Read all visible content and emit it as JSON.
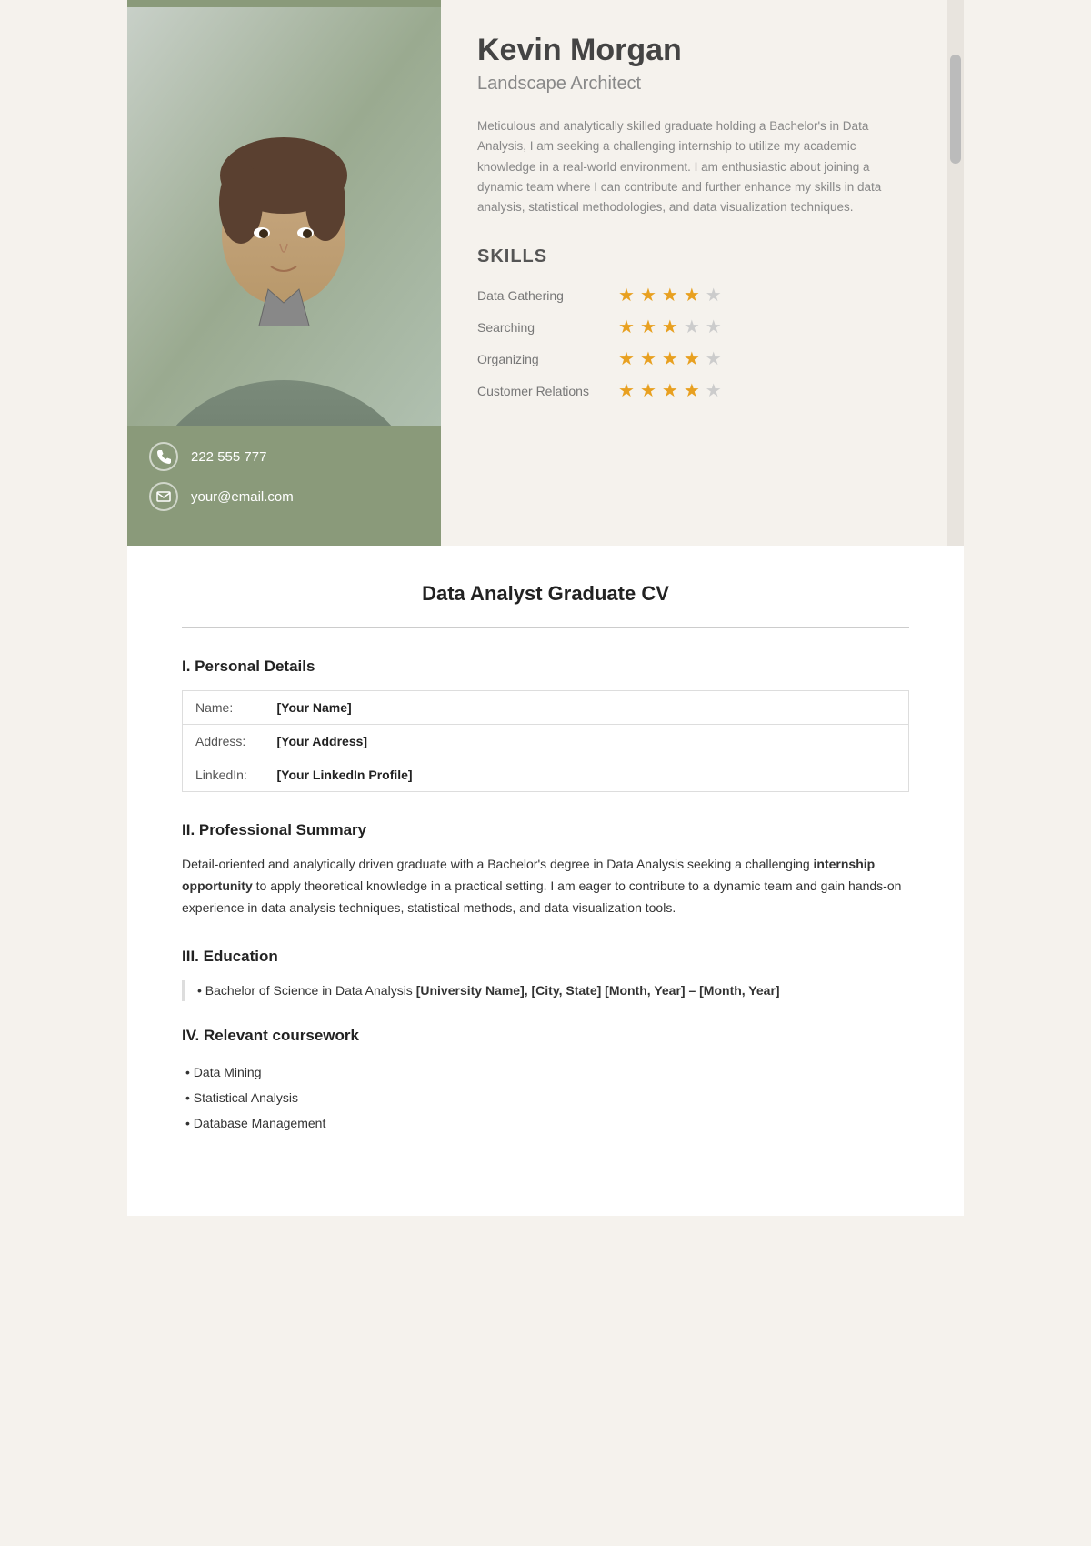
{
  "cv": {
    "name": "Kevin Morgan",
    "title": "Landscape Architect",
    "summary": "Meticulous and analytically skilled graduate holding a Bachelor's in Data Analysis, I am seeking a challenging internship to utilize my academic knowledge in a real-world environment. I am enthusiastic about joining a dynamic team where I can contribute and further enhance my skills in data analysis, statistical methodologies, and data visualization techniques.",
    "contact": {
      "phone": "222 555 777",
      "email": "your@email.com"
    },
    "skills_heading": "SKILLS",
    "skills": [
      {
        "name": "Data Gathering",
        "filled": 4,
        "empty": 1
      },
      {
        "name": "Searching",
        "filled": 3,
        "empty": 2
      },
      {
        "name": "Organizing",
        "filled": 4,
        "empty": 1
      },
      {
        "name": "Customer Relations",
        "filled": 4,
        "empty": 1
      }
    ]
  },
  "document": {
    "title": "Data Analyst Graduate CV",
    "sections": {
      "personal": {
        "heading": "I. Personal Details",
        "rows": [
          {
            "label": "Name:",
            "value": "[Your Name]"
          },
          {
            "label": "Address:",
            "value": "[Your Address]"
          },
          {
            "label": "LinkedIn:",
            "value": "[Your LinkedIn Profile]"
          }
        ]
      },
      "summary": {
        "heading": "II. Professional Summary",
        "text_start": "Detail-oriented and analytically driven graduate with a Bachelor's degree in Data Analysis seeking a challenging ",
        "text_bold": "internship opportunity",
        "text_end": " to apply theoretical knowledge in a practical setting. I am eager to contribute to a dynamic team and gain hands-on experience in data analysis techniques, statistical methods, and data visualization tools."
      },
      "education": {
        "heading": "III. Education",
        "item": "• Bachelor of Science in Data Analysis ",
        "item_bold": "[University Name], [City, State] [Month, Year] – [Month, Year]"
      },
      "coursework": {
        "heading": "IV. Relevant coursework",
        "items": [
          "Data Mining",
          "Statistical Analysis",
          "Database Management"
        ]
      }
    }
  }
}
